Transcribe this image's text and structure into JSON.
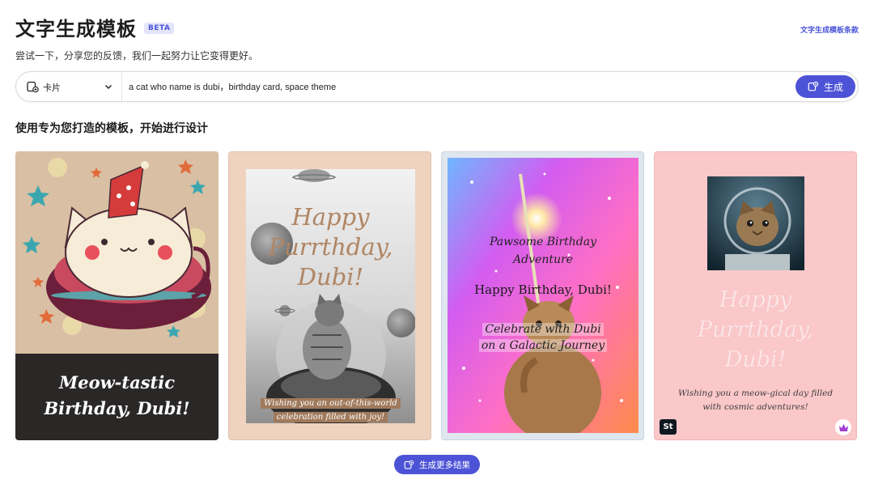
{
  "header": {
    "title": "文字生成模板",
    "badge": "BETA",
    "terms_link": "文字生成模板条款",
    "subtitle": "尝试一下，分享您的反馈，我们一起努力让它变得更好。"
  },
  "prompt_bar": {
    "type_label": "卡片",
    "type_icon": "card-plus-icon",
    "prompt_value": "a cat who name is dubi，birthday card, space theme",
    "generate_label": "生成",
    "generate_icon": "sparkle-plus-icon"
  },
  "section_title": "使用专为您打造的模板，开始进行设计",
  "cards": [
    {
      "lines": [
        "Meow-tastic",
        "Birthday, Dubi!"
      ]
    },
    {
      "title_lines": [
        "Happy",
        "Purrthday,",
        "Dubi!"
      ],
      "message_lines": [
        "Wishing you an out-of-this-world",
        "celebration filled with joy!"
      ]
    },
    {
      "heading_lines": [
        "Pawsome Birthday",
        "Adventure"
      ],
      "greeting": "Happy Birthday, Dubi!",
      "message_lines": [
        "Celebrate with Dubi",
        "on a Galactic Journey"
      ]
    },
    {
      "title_lines": [
        "Happy",
        "Purrthday,",
        "Dubi!"
      ],
      "message_lines": [
        "Wishing you a meow-gical day filled",
        "with cosmic adventures!"
      ],
      "stock_badge": "St",
      "premium_icon": "crown-icon"
    }
  ],
  "more_button": {
    "label": "生成更多结果",
    "icon": "sparkle-plus-icon"
  },
  "colors": {
    "accent": "#4d53d6",
    "beta_bg": "#e3e6fb"
  }
}
